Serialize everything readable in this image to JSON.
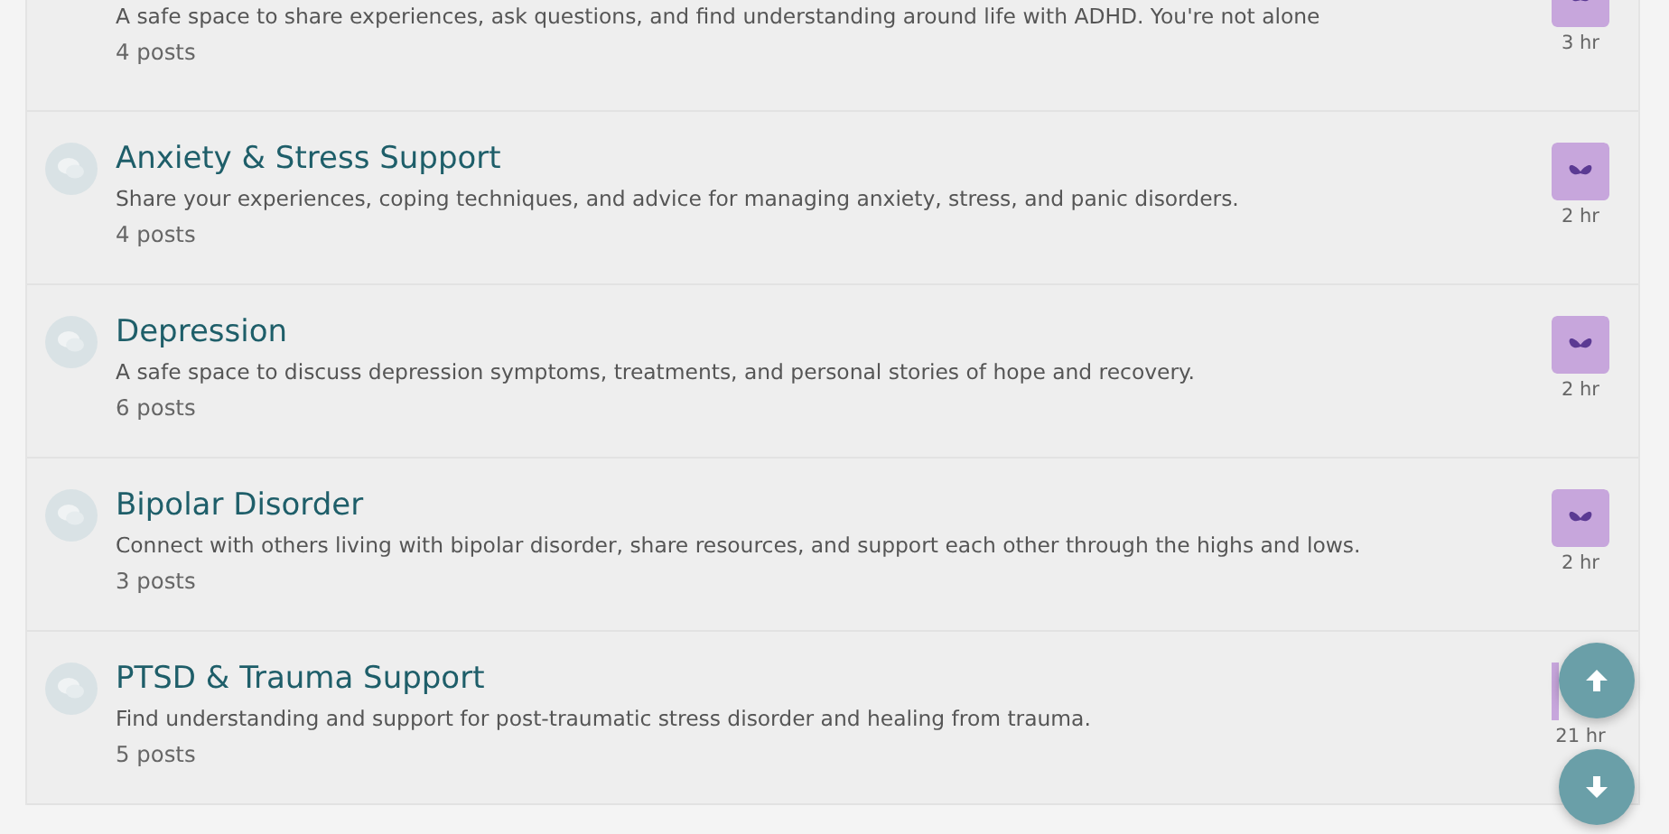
{
  "forums": [
    {
      "description": "A safe space to share experiences, ask questions, and find understanding around life with ADHD. You're not alone",
      "posts": "4 posts",
      "time": "3 hr"
    },
    {
      "title": "Anxiety & Stress Support",
      "description": "Share your experiences, coping techniques, and advice for managing anxiety, stress, and panic disorders.",
      "posts": "4 posts",
      "time": "2 hr"
    },
    {
      "title": "Depression",
      "description": "A safe space to discuss depression symptoms, treatments, and personal stories of hope and recovery.",
      "posts": "6 posts",
      "time": "2 hr"
    },
    {
      "title": "Bipolar Disorder",
      "description": "Connect with others living with bipolar disorder, share resources, and support each other through the highs and lows.",
      "posts": "3 posts",
      "time": "2 hr"
    },
    {
      "title": "PTSD & Trauma Support",
      "description": "Find understanding and support for post-traumatic stress disorder and healing from trauma.",
      "posts": "5 posts",
      "time": "21 hr"
    }
  ]
}
